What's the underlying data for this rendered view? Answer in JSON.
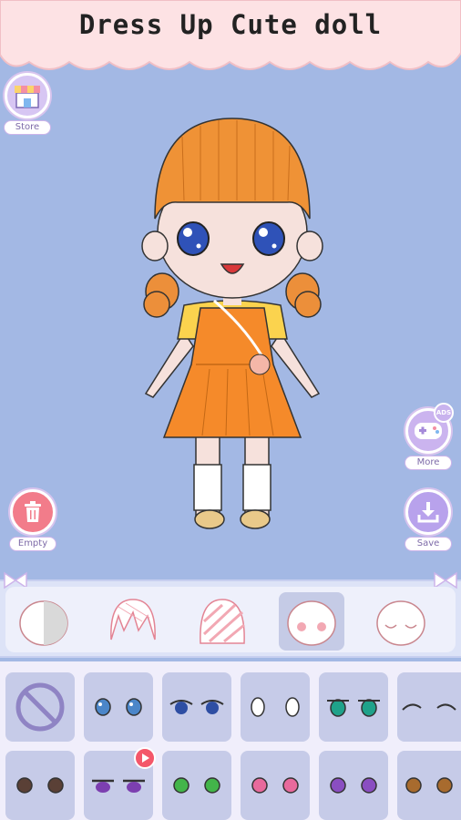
{
  "header": {
    "title": "Dress Up Cute doll"
  },
  "buttons": {
    "store_label": "Store",
    "more_label": "More",
    "ads_label": "ADS",
    "empty_label": "Empty",
    "save_label": "Save"
  },
  "icons": {
    "store": "store-icon",
    "more": "gamepad-icon",
    "empty": "trash-icon",
    "save": "download-icon"
  },
  "categories": [
    {
      "name": "skin",
      "active": false
    },
    {
      "name": "hair-front",
      "active": false
    },
    {
      "name": "hair-back",
      "active": false
    },
    {
      "name": "face",
      "active": true
    },
    {
      "name": "face-expression",
      "active": false
    }
  ],
  "eye_options_row1": [
    "none",
    "blue-eyes",
    "navy-eyes",
    "outline-eyes",
    "teal-eyes",
    "closed-eyes"
  ],
  "eye_options_row2": [
    "brown-eyes",
    "purple-eyes",
    "green-eyes",
    "pink-eyes",
    "violet-eyes",
    "amber-eyes"
  ],
  "colors": {
    "background": "#a3b8e4",
    "banner": "#fde2e4",
    "accent": "#c9b3ee",
    "empty_button": "#f27c8a",
    "active_category": "#c5cbe6"
  }
}
